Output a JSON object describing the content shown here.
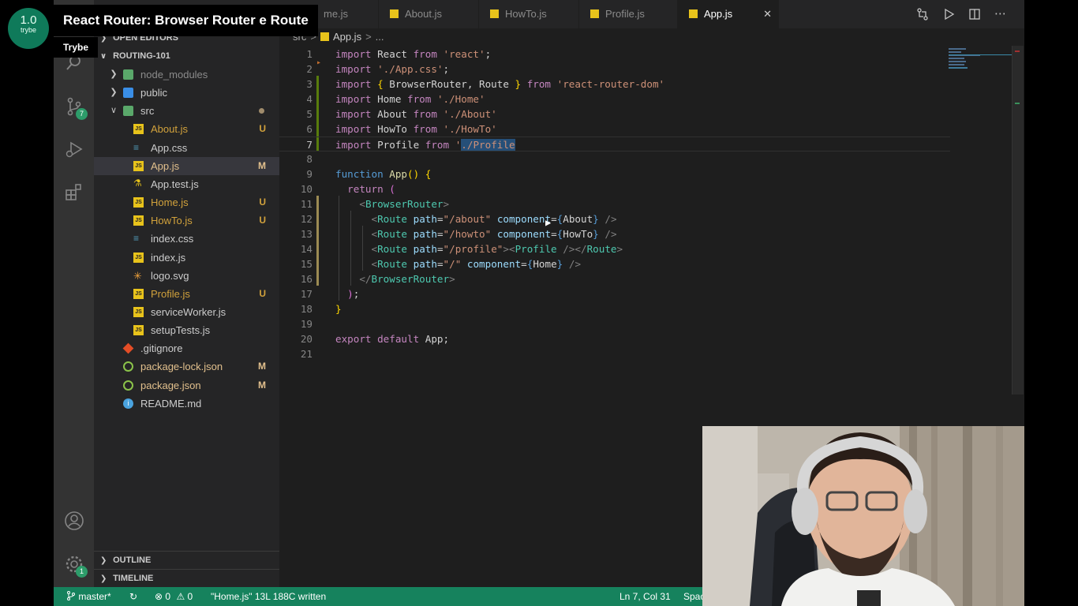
{
  "overlay": {
    "channel_avatar_version": "1.0",
    "channel_avatar_brand": "trybe",
    "video_title": "React Router: Browser Router e Route",
    "channel_tooltip": "Trybe"
  },
  "activity_bar": {
    "icons": [
      "files-icon",
      "search-icon",
      "source-control-icon",
      "run-debug-icon",
      "extensions-icon",
      "accounts-icon",
      "settings-gear-icon"
    ],
    "source_control_badge": "7",
    "settings_badge": "1"
  },
  "sidebar": {
    "open_editors_label": "OPEN EDITORS",
    "project_label": "ROUTING-101",
    "items": [
      {
        "name": "node_modules",
        "type": "folder",
        "depth": 1,
        "expanded": false,
        "status": "",
        "color": "muted"
      },
      {
        "name": "public",
        "type": "folder",
        "depth": 1,
        "expanded": false,
        "status": "",
        "color": "plain"
      },
      {
        "name": "src",
        "type": "folder",
        "depth": 1,
        "expanded": true,
        "status": "dot",
        "color": "plain"
      },
      {
        "name": "About.js",
        "type": "js",
        "depth": 2,
        "status": "U",
        "color": "untracked"
      },
      {
        "name": "App.css",
        "type": "css",
        "depth": 2,
        "status": "",
        "color": "plain"
      },
      {
        "name": "App.js",
        "type": "js",
        "depth": 2,
        "status": "M",
        "color": "modified",
        "active": true
      },
      {
        "name": "App.test.js",
        "type": "test",
        "depth": 2,
        "status": "",
        "color": "plain"
      },
      {
        "name": "Home.js",
        "type": "js",
        "depth": 2,
        "status": "U",
        "color": "untracked"
      },
      {
        "name": "HowTo.js",
        "type": "js",
        "depth": 2,
        "status": "U",
        "color": "untracked"
      },
      {
        "name": "index.css",
        "type": "css",
        "depth": 2,
        "status": "",
        "color": "plain"
      },
      {
        "name": "index.js",
        "type": "js",
        "depth": 2,
        "status": "",
        "color": "plain"
      },
      {
        "name": "logo.svg",
        "type": "svg",
        "depth": 2,
        "status": "",
        "color": "plain"
      },
      {
        "name": "Profile.js",
        "type": "js",
        "depth": 2,
        "status": "U",
        "color": "untracked"
      },
      {
        "name": "serviceWorker.js",
        "type": "js",
        "depth": 2,
        "status": "",
        "color": "plain"
      },
      {
        "name": "setupTests.js",
        "type": "js",
        "depth": 2,
        "status": "",
        "color": "plain"
      },
      {
        "name": ".gitignore",
        "type": "git",
        "depth": 1,
        "status": "",
        "color": "plain"
      },
      {
        "name": "package-lock.json",
        "type": "json",
        "depth": 1,
        "status": "M",
        "color": "modified"
      },
      {
        "name": "package.json",
        "type": "json",
        "depth": 1,
        "status": "M",
        "color": "modified"
      },
      {
        "name": "README.md",
        "type": "info",
        "depth": 1,
        "status": "",
        "color": "plain"
      }
    ],
    "outline_label": "OUTLINE",
    "timeline_label": "TIMELINE"
  },
  "tabs": [
    {
      "label": "me.js",
      "active": false
    },
    {
      "label": "About.js",
      "active": false
    },
    {
      "label": "HowTo.js",
      "active": false
    },
    {
      "label": "Profile.js",
      "active": false
    },
    {
      "label": "App.js",
      "active": true,
      "close": "✕"
    }
  ],
  "tab_actions": [
    "compare-changes-icon",
    "run-icon",
    "split-editor-icon",
    "more-actions-icon"
  ],
  "breadcrumb": {
    "folder": "src",
    "sep": ">",
    "file": "App.js",
    "rest": "..."
  },
  "editor": {
    "lines": [
      {
        "n": "1",
        "tokens": [
          [
            "kw",
            "import"
          ],
          [
            "p",
            " React "
          ],
          [
            "kw",
            "from"
          ],
          [
            "p",
            " "
          ],
          [
            "str",
            "'react'"
          ],
          [
            "p",
            ";"
          ]
        ]
      },
      {
        "n": "2",
        "tokens": [
          [
            "kw",
            "import"
          ],
          [
            "p",
            " "
          ],
          [
            "str",
            "'./App.css'"
          ],
          [
            "p",
            ";"
          ]
        ]
      },
      {
        "n": "3",
        "tokens": [
          [
            "kw",
            "import"
          ],
          [
            "p",
            " "
          ],
          [
            "br1",
            "{"
          ],
          [
            "p",
            " BrowserRouter, Route "
          ],
          [
            "br1",
            "}"
          ],
          [
            "p",
            " "
          ],
          [
            "kw",
            "from"
          ],
          [
            "p",
            " "
          ],
          [
            "str",
            "'react-router-dom'"
          ]
        ]
      },
      {
        "n": "4",
        "tokens": [
          [
            "kw",
            "import"
          ],
          [
            "p",
            " Home "
          ],
          [
            "kw",
            "from"
          ],
          [
            "p",
            " "
          ],
          [
            "str",
            "'./Home'"
          ]
        ]
      },
      {
        "n": "5",
        "tokens": [
          [
            "kw",
            "import"
          ],
          [
            "p",
            " About "
          ],
          [
            "kw",
            "from"
          ],
          [
            "p",
            " "
          ],
          [
            "str",
            "'./About'"
          ]
        ]
      },
      {
        "n": "6",
        "tokens": [
          [
            "kw",
            "import"
          ],
          [
            "p",
            " HowTo "
          ],
          [
            "kw",
            "from"
          ],
          [
            "p",
            " "
          ],
          [
            "str",
            "'./HowTo'"
          ]
        ]
      },
      {
        "n": "7",
        "tokens": [
          [
            "kw",
            "import"
          ],
          [
            "p",
            " Profile "
          ],
          [
            "kw",
            "from"
          ],
          [
            "p",
            " "
          ],
          [
            "str",
            "'"
          ],
          [
            "strsel",
            "./Profile"
          ]
        ]
      },
      {
        "n": "8",
        "tokens": []
      },
      {
        "n": "9",
        "tokens": [
          [
            "blue",
            "function"
          ],
          [
            "p",
            " "
          ],
          [
            "fn",
            "App"
          ],
          [
            "br1",
            "()"
          ],
          [
            "p",
            " "
          ],
          [
            "br1",
            "{"
          ]
        ]
      },
      {
        "n": "10",
        "tokens": [
          [
            "p",
            "  "
          ],
          [
            "kw",
            "return"
          ],
          [
            "p",
            " "
          ],
          [
            "br2",
            "("
          ]
        ]
      },
      {
        "n": "11",
        "tokens": [
          [
            "p",
            "    "
          ],
          [
            "gray",
            "<"
          ],
          [
            "tag",
            "BrowserRouter"
          ],
          [
            "gray",
            ">"
          ]
        ]
      },
      {
        "n": "12",
        "tokens": [
          [
            "p",
            "      "
          ],
          [
            "gray",
            "<"
          ],
          [
            "tag",
            "Route"
          ],
          [
            "p",
            " "
          ],
          [
            "var",
            "path"
          ],
          [
            "p",
            "="
          ],
          [
            "str",
            "\"/about\""
          ],
          [
            "p",
            " "
          ],
          [
            "var",
            "component"
          ],
          [
            "p",
            "="
          ],
          [
            "blue",
            "{"
          ],
          [
            "p",
            "About"
          ],
          [
            "blue",
            "}"
          ],
          [
            "p",
            " "
          ],
          [
            "gray",
            "/>"
          ]
        ]
      },
      {
        "n": "13",
        "tokens": [
          [
            "p",
            "      "
          ],
          [
            "gray",
            "<"
          ],
          [
            "tag",
            "Route"
          ],
          [
            "p",
            " "
          ],
          [
            "var",
            "path"
          ],
          [
            "p",
            "="
          ],
          [
            "str",
            "\"/howto\""
          ],
          [
            "p",
            " "
          ],
          [
            "var",
            "component"
          ],
          [
            "p",
            "="
          ],
          [
            "blue",
            "{"
          ],
          [
            "p",
            "HowTo"
          ],
          [
            "blue",
            "}"
          ],
          [
            "p",
            " "
          ],
          [
            "gray",
            "/>"
          ]
        ]
      },
      {
        "n": "14",
        "tokens": [
          [
            "p",
            "      "
          ],
          [
            "gray",
            "<"
          ],
          [
            "tag",
            "Route"
          ],
          [
            "p",
            " "
          ],
          [
            "var",
            "path"
          ],
          [
            "p",
            "="
          ],
          [
            "str",
            "\"/profile\""
          ],
          [
            "gray",
            ">"
          ],
          [
            "gray",
            "<"
          ],
          [
            "tag",
            "Profile"
          ],
          [
            "p",
            " "
          ],
          [
            "gray",
            "/>"
          ],
          [
            "gray",
            "</"
          ],
          [
            "tag",
            "Route"
          ],
          [
            "gray",
            ">"
          ]
        ]
      },
      {
        "n": "15",
        "tokens": [
          [
            "p",
            "      "
          ],
          [
            "gray",
            "<"
          ],
          [
            "tag",
            "Route"
          ],
          [
            "p",
            " "
          ],
          [
            "var",
            "path"
          ],
          [
            "p",
            "="
          ],
          [
            "str",
            "\"/\""
          ],
          [
            "p",
            " "
          ],
          [
            "var",
            "component"
          ],
          [
            "p",
            "="
          ],
          [
            "blue",
            "{"
          ],
          [
            "p",
            "Home"
          ],
          [
            "blue",
            "}"
          ],
          [
            "p",
            " "
          ],
          [
            "gray",
            "/>"
          ]
        ]
      },
      {
        "n": "16",
        "tokens": [
          [
            "p",
            "    "
          ],
          [
            "gray",
            "</"
          ],
          [
            "tag",
            "BrowserRouter"
          ],
          [
            "gray",
            ">"
          ]
        ]
      },
      {
        "n": "17",
        "tokens": [
          [
            "p",
            "  "
          ],
          [
            "br2",
            ")"
          ],
          [
            "p",
            ";"
          ]
        ]
      },
      {
        "n": "18",
        "tokens": [
          [
            "br1",
            "}"
          ]
        ]
      },
      {
        "n": "19",
        "tokens": []
      },
      {
        "n": "20",
        "tokens": [
          [
            "kw",
            "export"
          ],
          [
            "p",
            " "
          ],
          [
            "kw",
            "default"
          ],
          [
            "p",
            " App;"
          ]
        ]
      },
      {
        "n": "21",
        "tokens": []
      }
    ]
  },
  "status_bar": {
    "branch": "master*",
    "errors": "0",
    "warnings": "0",
    "message": "\"Home.js\" 13L 188C written",
    "cursor": "Ln 7, Col 31",
    "spaces": "Spac"
  },
  "colors": {
    "status_bar": "#16825d",
    "activity_bar": "#333333",
    "sidebar": "#252526",
    "editor": "#1e1e1e",
    "js_icon": "#e8c31b"
  }
}
